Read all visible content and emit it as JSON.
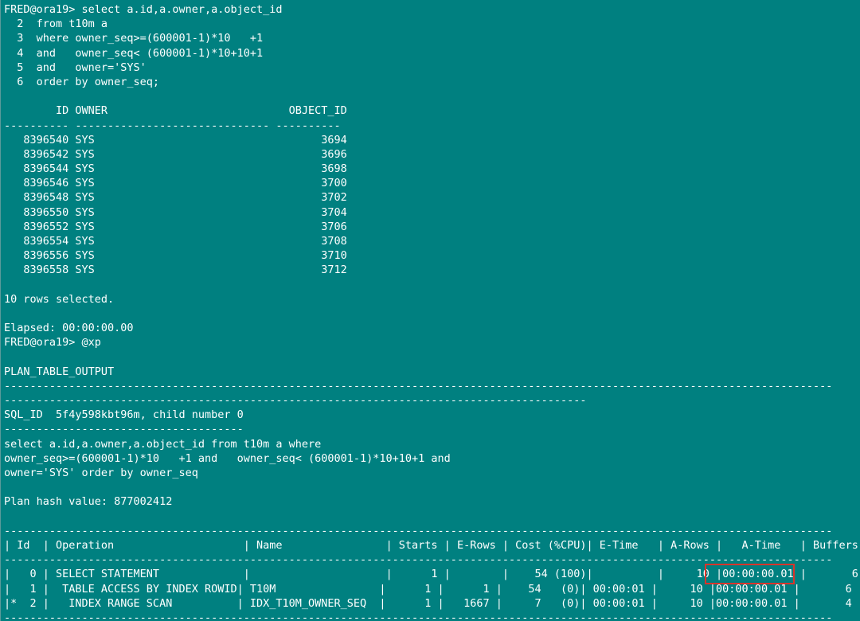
{
  "terminal": {
    "lines": [
      "FRED@ora19> select a.id,a.owner,a.object_id",
      "  2  from t10m a",
      "  3  where owner_seq>=(600001-1)*10   +1",
      "  4  and   owner_seq< (600001-1)*10+10+1",
      "  5  and   owner='SYS'",
      "  6  order by owner_seq;",
      "",
      "        ID OWNER                            OBJECT_ID",
      "---------- ------------------------------ ----------",
      "   8396540 SYS                                   3694",
      "   8396542 SYS                                   3696",
      "   8396544 SYS                                   3698",
      "   8396546 SYS                                   3700",
      "   8396548 SYS                                   3702",
      "   8396550 SYS                                   3704",
      "   8396552 SYS                                   3706",
      "   8396554 SYS                                   3708",
      "   8396556 SYS                                   3710",
      "   8396558 SYS                                   3712",
      "",
      "10 rows selected.",
      "",
      "Elapsed: 00:00:00.00",
      "FRED@ora19> @xp",
      "",
      "PLAN_TABLE_OUTPUT",
      "--------------------------------------------------------------------------------------------------------------------------------",
      "------------------------------------------------------------------------------------------",
      "SQL_ID  5f4y598kbt96m, child number 0",
      "-------------------------------------",
      "select a.id,a.owner,a.object_id from t10m a where",
      "owner_seq>=(600001-1)*10   +1 and   owner_seq< (600001-1)*10+10+1 and",
      "owner='SYS' order by owner_seq",
      "",
      "Plan hash value: 877002412",
      "",
      "--------------------------------------------------------------------------------------------------------------------------------",
      "| Id  | Operation                    | Name                | Starts | E-Rows | Cost (%CPU)| E-Time   | A-Rows |   A-Time   | Buffers |",
      "--------------------------------------------------------------------------------------------------------------------------------",
      "|   0 | SELECT STATEMENT             |                     |      1 |        |    54 (100)|          |     10 |00:00:00.01 |       6 |",
      "|   1 |  TABLE ACCESS BY INDEX ROWID| T10M                |      1 |      1 |    54   (0)| 00:00:01 |     10 |00:00:00.01 |       6 |",
      "|*  2 |   INDEX RANGE SCAN          | IDX_T10M_OWNER_SEQ  |      1 |   1667 |     7   (0)| 00:00:01 |     10 |00:00:00.01 |       4 |",
      "--------------------------------------------------------------------------------------------------------------------------------"
    ]
  }
}
